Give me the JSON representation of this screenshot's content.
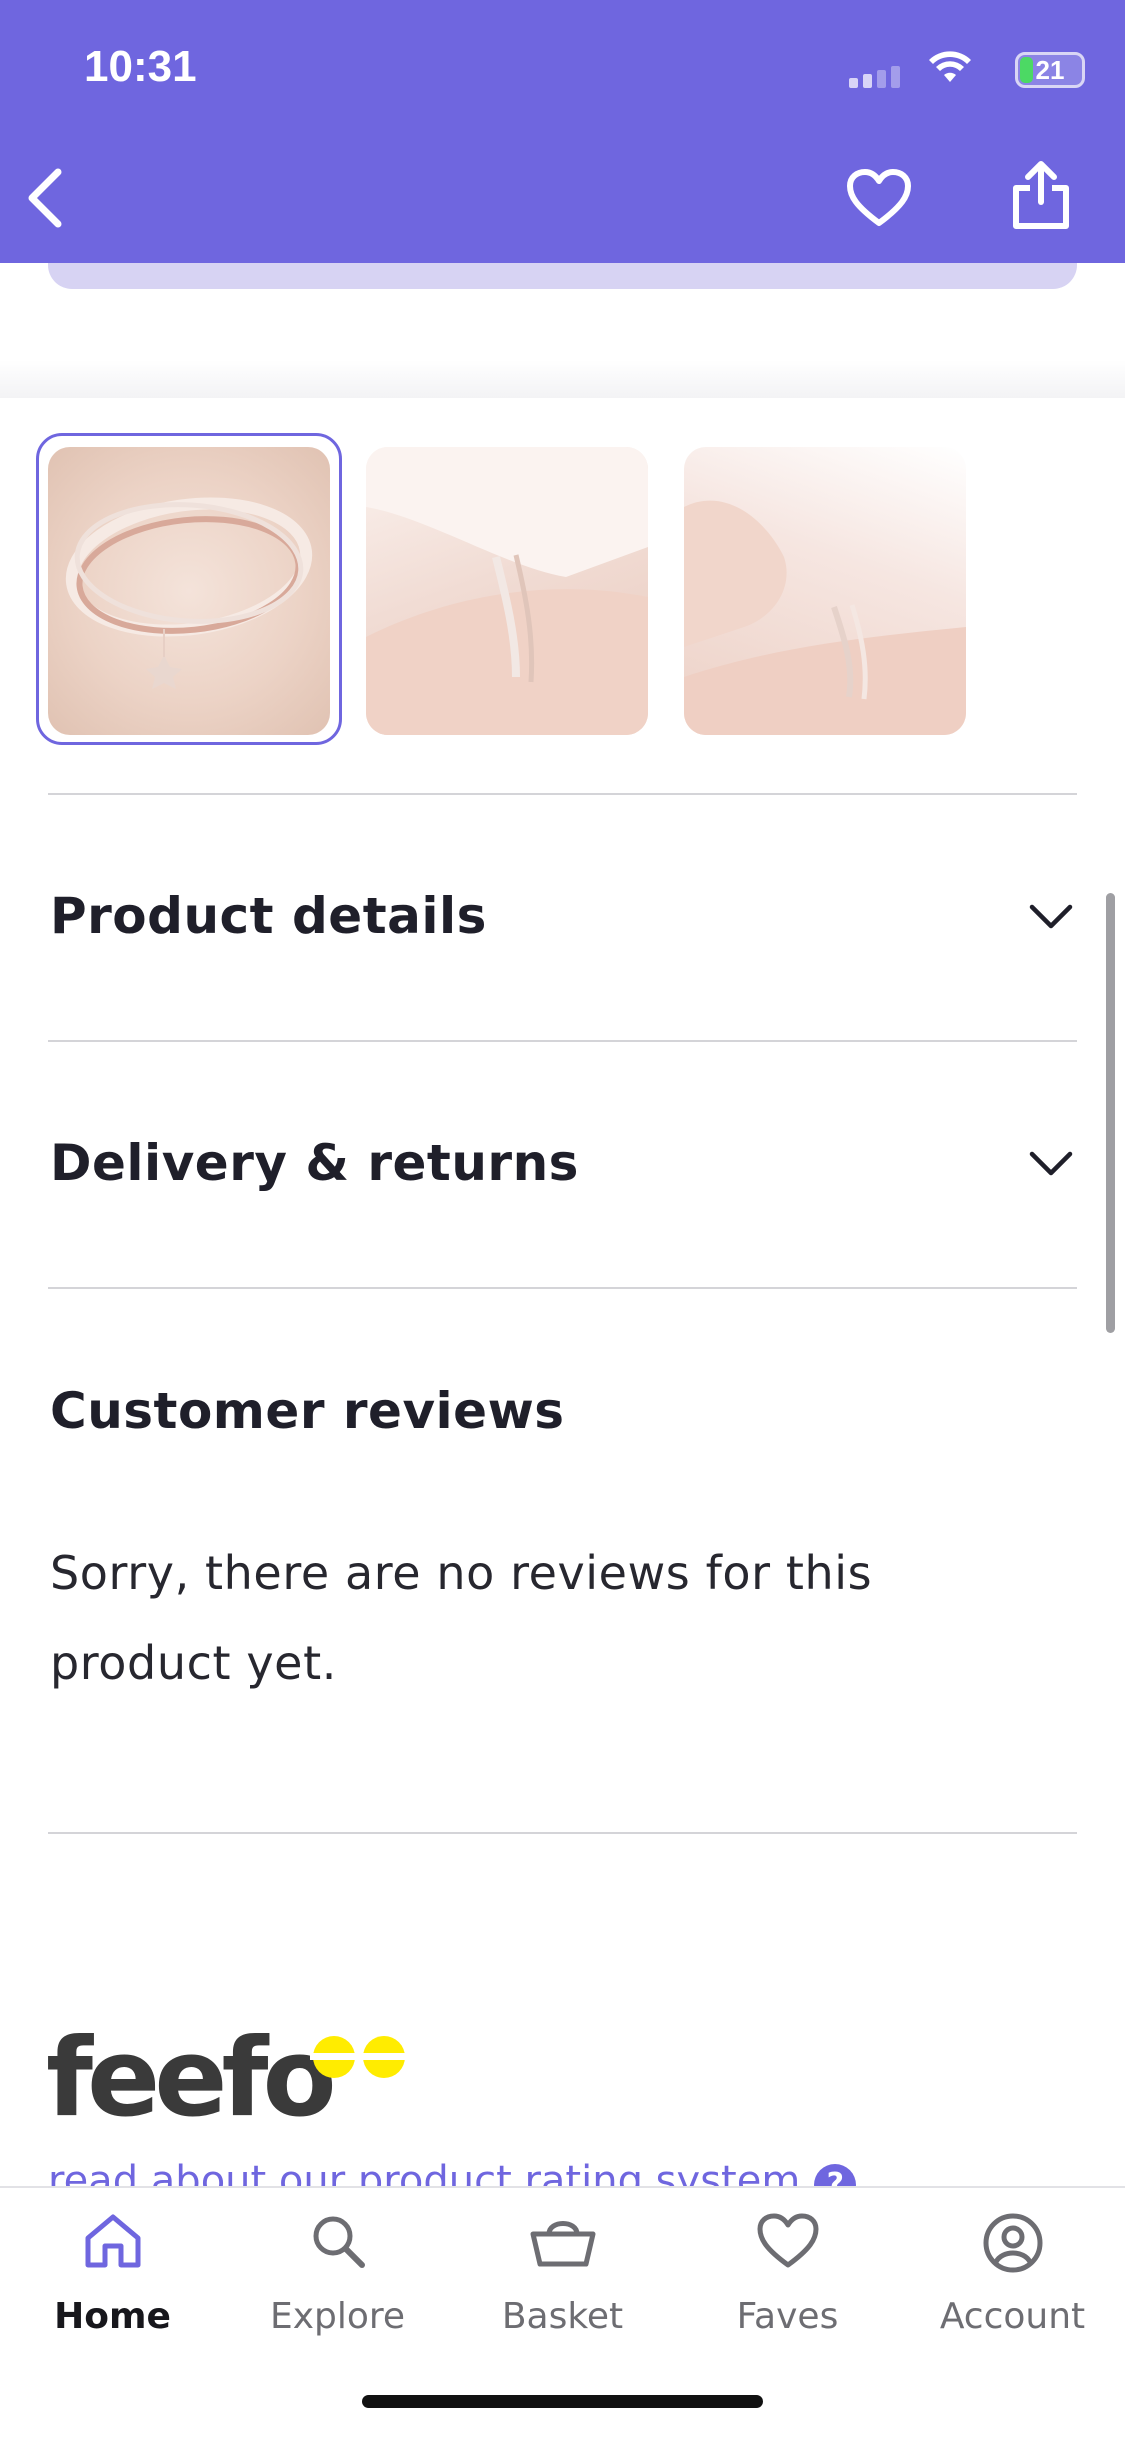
{
  "status_bar": {
    "time": "10:31",
    "battery": "21"
  },
  "header": {
    "back_icon": "chevron-left-icon",
    "favourite_icon": "heart-icon",
    "share_icon": "share-icon",
    "bg_color": "#6f66df"
  },
  "gallery": {
    "thumbnails": [
      {
        "alt": "bracelet with star charm",
        "selected": true
      },
      {
        "alt": "bracelet worn on wrist",
        "selected": false
      },
      {
        "alt": "bracelet worn on wrist close up",
        "selected": false
      }
    ]
  },
  "sections": {
    "product_details": "Product details",
    "delivery_returns": "Delivery & returns",
    "customer_reviews": "Customer reviews",
    "no_reviews_text": "Sorry, there are no reviews for this product yet."
  },
  "feefo": {
    "logo_text": "feefo",
    "link_text": "read about our product rating system",
    "help": "?"
  },
  "tabbar": {
    "items": [
      {
        "label": "Home",
        "icon": "home-icon",
        "active": true
      },
      {
        "label": "Explore",
        "icon": "search-icon",
        "active": false
      },
      {
        "label": "Basket",
        "icon": "basket-icon",
        "active": false
      },
      {
        "label": "Faves",
        "icon": "heart-icon",
        "active": false
      },
      {
        "label": "Account",
        "icon": "account-icon",
        "active": false
      }
    ]
  },
  "colors": {
    "accent": "#6f66df",
    "text": "#1f1f2a"
  }
}
